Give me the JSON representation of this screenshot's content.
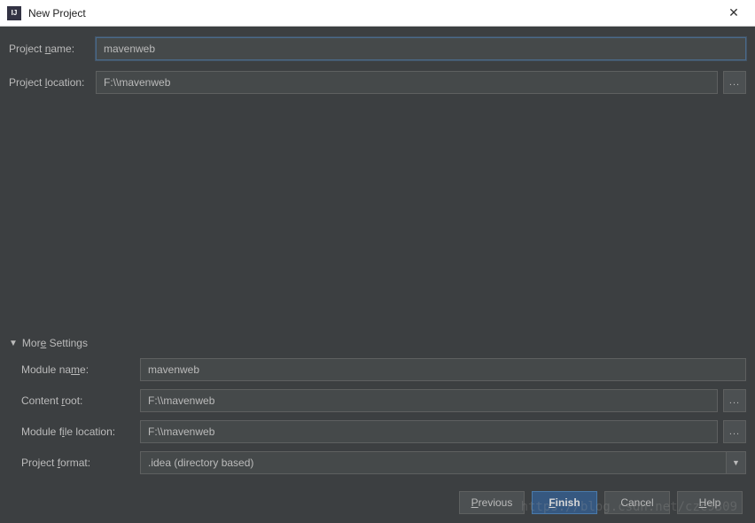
{
  "window": {
    "title": "New Project"
  },
  "form": {
    "projectName": {
      "label_pre": "Project ",
      "label_u": "n",
      "label_post": "ame:",
      "value": "mavenweb"
    },
    "projectLocation": {
      "label_pre": "Project ",
      "label_u": "l",
      "label_post": "ocation:",
      "value": "F:\\\\mavenweb"
    }
  },
  "moreSettings": {
    "header_pre": "Mor",
    "header_u": "e",
    "header_post": " Settings",
    "moduleName": {
      "label_pre": "Module na",
      "label_u": "m",
      "label_post": "e:",
      "value": "mavenweb"
    },
    "contentRoot": {
      "label_pre": "Content ",
      "label_u": "r",
      "label_post": "oot:",
      "value": "F:\\\\mavenweb"
    },
    "moduleFileLocation": {
      "label_pre": "Module f",
      "label_u": "i",
      "label_post": "le location:",
      "value": "F:\\\\mavenweb"
    },
    "projectFormat": {
      "label_pre": "Project ",
      "label_u": "f",
      "label_post": "ormat:",
      "value": ".idea (directory based)"
    }
  },
  "buttons": {
    "previous": {
      "u": "P",
      "rest": "revious"
    },
    "finish": {
      "u": "F",
      "rest": "inish"
    },
    "cancel": "Cancel",
    "help": {
      "pre": "",
      "u": "H",
      "rest": "elp"
    }
  },
  "browse": "...",
  "watermark": "https://blog.csdn.net/czc9309"
}
